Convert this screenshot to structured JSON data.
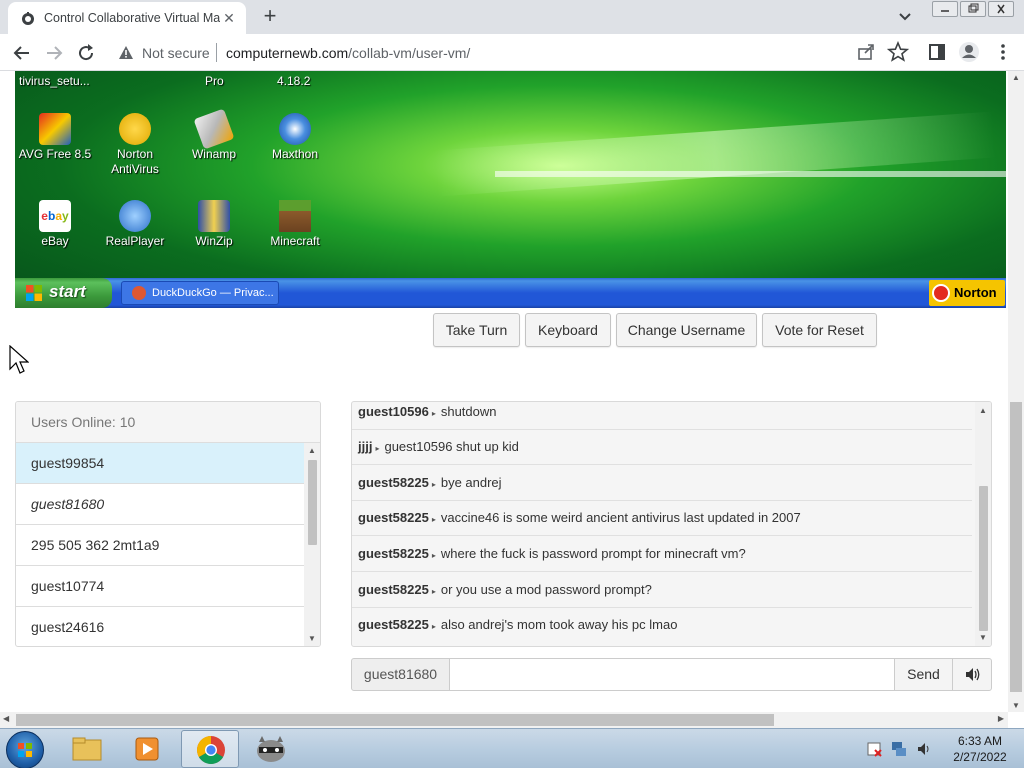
{
  "browser": {
    "tab_title": "Control Collaborative Virtual Mac",
    "security_label": "Not secure",
    "url_domain": "computernewb.com",
    "url_path": "/collab-vm/user-vm/"
  },
  "vm_desktop": {
    "top_labels": [
      "tivirus_setu...",
      "Pro",
      "4.18.2"
    ],
    "icons": [
      {
        "label": "AVG Free 8.5",
        "icon": "avg-icon"
      },
      {
        "label": "Norton AntiVirus",
        "icon": "norton-antivirus-icon"
      },
      {
        "label": "Winamp",
        "icon": "winamp-icon"
      },
      {
        "label": "Maxthon",
        "icon": "maxthon-icon"
      },
      {
        "label": "eBay",
        "icon": "ebay-icon"
      },
      {
        "label": "RealPlayer",
        "icon": "realplayer-icon"
      },
      {
        "label": "WinZip",
        "icon": "winzip-icon"
      },
      {
        "label": "Minecraft",
        "icon": "minecraft-icon"
      }
    ],
    "start_label": "start",
    "task_label": "DuckDuckGo — Privac...",
    "tray_label": "Norton"
  },
  "controls": {
    "take_turn": "Take Turn",
    "keyboard": "Keyboard",
    "change_username": "Change Username",
    "vote_reset": "Vote for Reset"
  },
  "users": {
    "header": "Users Online: 10",
    "list": [
      {
        "name": "guest99854",
        "highlighted": true
      },
      {
        "name": "guest81680",
        "italic": true
      },
      {
        "name": "295 505 362 2mt1a9"
      },
      {
        "name": "guest10774"
      },
      {
        "name": "guest24616"
      }
    ]
  },
  "chat": {
    "messages": [
      {
        "user": "guest10596",
        "text": "shutdown"
      },
      {
        "user": "jjjj",
        "text": "guest10596 shut up kid"
      },
      {
        "user": "guest58225",
        "text": "bye andrej"
      },
      {
        "user": "guest58225",
        "text": "vaccine46 is some weird ancient antivirus last updated in 2007"
      },
      {
        "user": "guest58225",
        "text": "where the fuck is password prompt for minecraft vm?"
      },
      {
        "user": "guest58225",
        "text": "or you use a mod password prompt?"
      },
      {
        "user": "guest58225",
        "text": "also andrej's mom took away his pc lmao"
      }
    ],
    "username": "guest81680",
    "input_value": "",
    "send_label": "Send"
  },
  "taskbar": {
    "time": "6:33 AM",
    "date": "2/27/2022"
  }
}
